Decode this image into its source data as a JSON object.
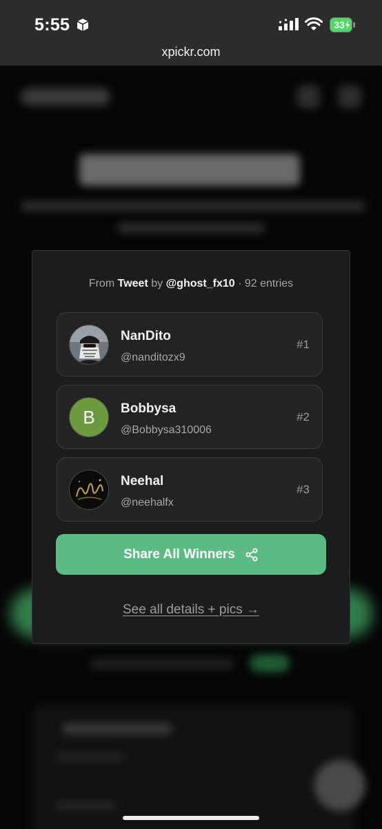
{
  "status_bar": {
    "time": "5:55",
    "battery_level": "33",
    "battery_color": "#4cd964"
  },
  "browser": {
    "url": "xpickr.com"
  },
  "modal": {
    "source": {
      "prefix": "From",
      "source_type": "Tweet",
      "by": "by",
      "author": "@ghost_fx10",
      "separator": "·",
      "entries": "92 entries"
    },
    "winners": [
      {
        "name": "NanDito",
        "handle": "@nanditozx9",
        "rank": "#1",
        "avatar": "photo"
      },
      {
        "name": "Bobbysa",
        "handle": "@Bobbysa310006",
        "rank": "#2",
        "avatar_letter": "B",
        "avatar_color": "#6b9b3e"
      },
      {
        "name": "Neehal",
        "handle": "@neehalfx",
        "rank": "#3",
        "avatar": "photo"
      }
    ],
    "share_button": {
      "label": "Share All Winners",
      "icon": "share-icon",
      "color": "#5bbb83"
    },
    "details_link": "See all details + pics →"
  }
}
